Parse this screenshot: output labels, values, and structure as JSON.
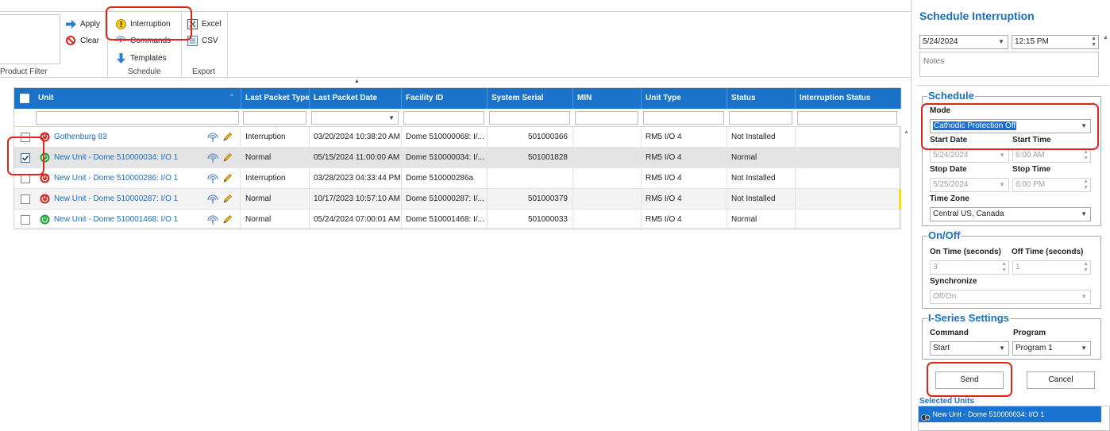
{
  "ribbon": {
    "product_filter_label": "Product Filter",
    "apply_label": "Apply",
    "clear_label": "Clear",
    "interruption_label": "Interruption",
    "commands_label": "Commands",
    "templates_label": "Templates",
    "schedule_group": "Schedule",
    "excel_label": "Excel",
    "csv_label": "CSV",
    "export_group": "Export"
  },
  "grid": {
    "columns": [
      "Unit",
      "Last Packet Type",
      "Last Packet Date",
      "Facility ID",
      "System Serial",
      "MIN",
      "Unit Type",
      "Status",
      "Interruption Status"
    ],
    "rows": [
      {
        "unit": "Gothenburg 83",
        "packet_type": "Interruption",
        "packet_date": "03/20/2024 10:38:20 AM",
        "facility": "Dome 510000068: I/...",
        "serial": "501000366",
        "min": "",
        "unit_type": "RM5 I/O 4",
        "status": "Not Installed",
        "int_status": "",
        "power": "red",
        "checked": false
      },
      {
        "unit": "New Unit - Dome 510000034: I/O 1",
        "packet_type": "Normal",
        "packet_date": "05/15/2024 11:00:00 AM",
        "facility": "Dome 510000034: I/...",
        "serial": "501001828",
        "min": "",
        "unit_type": "RM5 I/O 4",
        "status": "Normal",
        "int_status": "",
        "power": "green",
        "checked": true
      },
      {
        "unit": "New Unit - Dome 510000286: I/O 1",
        "packet_type": "Interruption",
        "packet_date": "03/28/2023 04:33:44 PM",
        "facility": "Dome 510000286a",
        "serial": "",
        "min": "",
        "unit_type": "RM5 I/O 4",
        "status": "Not Installed",
        "int_status": "",
        "power": "red",
        "checked": false
      },
      {
        "unit": "New Unit - Dome 510000287: I/O 1",
        "packet_type": "Normal",
        "packet_date": "10/17/2023 10:57:10 AM",
        "facility": "Dome 510000287: I/...",
        "serial": "501000379",
        "min": "",
        "unit_type": "RM5 I/O 4",
        "status": "Not Installed",
        "int_status": "",
        "power": "red",
        "checked": false
      },
      {
        "unit": "New Unit - Dome 510001468: I/O 1",
        "packet_type": "Normal",
        "packet_date": "05/24/2024 07:00:01 AM",
        "facility": "Dome 510001468: I/...",
        "serial": "501000033",
        "min": "",
        "unit_type": "RM5 I/O 4",
        "status": "Normal",
        "int_status": "",
        "power": "green",
        "checked": false
      }
    ]
  },
  "panel": {
    "title": "Schedule Interruption",
    "date": "5/24/2024",
    "time": "12:15 PM",
    "notes_placeholder": "Notes",
    "schedule_legend": "Schedule",
    "mode_label": "Mode",
    "mode_value": "Cathodic Protection Off",
    "start_date_label": "Start Date",
    "start_time_label": "Start Time",
    "start_date": "5/24/2024",
    "start_time": "6:00 AM",
    "stop_date_label": "Stop Date",
    "stop_time_label": "Stop Time",
    "stop_date": "5/25/2024",
    "stop_time": "6:00 PM",
    "timezone_label": "Time Zone",
    "timezone": "Central US, Canada",
    "onoff_legend": "On/Off",
    "on_time_label": "On Time (seconds)",
    "off_time_label": "Off Time (seconds)",
    "on_time": "3",
    "off_time": "1",
    "sync_label": "Synchronize",
    "sync_value": "Off/On",
    "iseries_legend": "I-Series Settings",
    "command_label": "Command",
    "program_label": "Program",
    "command_value": "Start",
    "program_value": "Program 1",
    "send_label": "Send",
    "cancel_label": "Cancel",
    "selected_units_label": "Selected Units",
    "selected_unit": "New Unit - Dome 510000034: I/O 1"
  },
  "colors": {
    "header_blue": "#1a73c8",
    "accent": "#1a6fc0",
    "highlight": "#e0231b"
  }
}
